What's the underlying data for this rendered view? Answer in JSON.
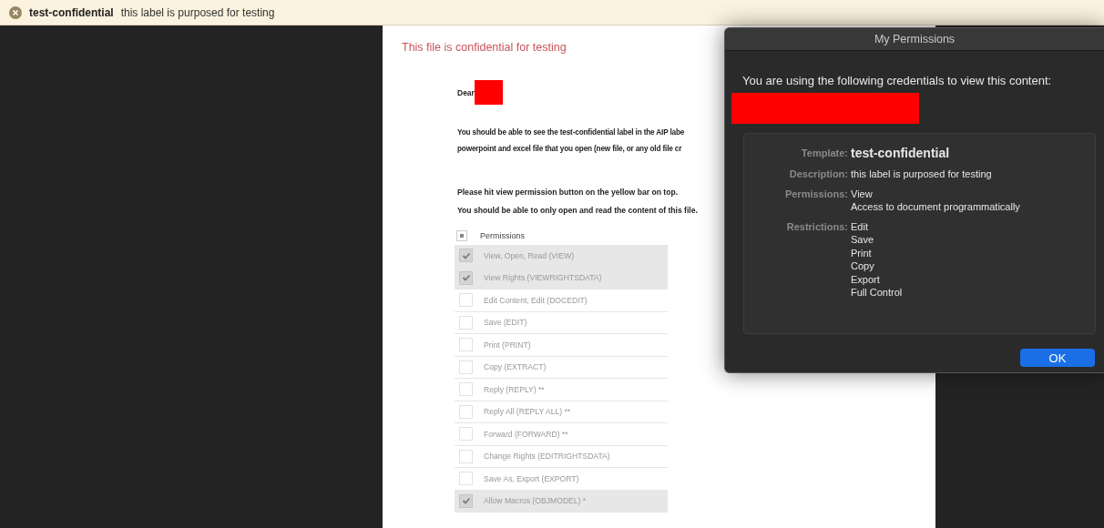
{
  "banner": {
    "label": "test-confidential",
    "description": "this label is purposed for testing"
  },
  "document": {
    "heading": "This file is confidential for testing",
    "greeting": "Dear",
    "paragraph_lines": [
      "You should be able to see the test-confidential label in the AIP labe",
      "powerpoint and excel file that you open (new file, or any old file cr"
    ],
    "instructions": [
      "Please hit view permission button on the yellow bar on top.",
      "You should be able to only open and read the content of this file."
    ],
    "permissions_table": {
      "header": "Permissions",
      "header_indeterminate": true,
      "rows": [
        {
          "label": "View, Open, Read (VIEW)",
          "checked": true
        },
        {
          "label": "View Rights (VIEWRIGHTSDATA)",
          "checked": true
        },
        {
          "label": "Edit Content, Edit (DOCEDIT)",
          "checked": false
        },
        {
          "label": "Save (EDIT)",
          "checked": false
        },
        {
          "label": "Print (PRINT)",
          "checked": false
        },
        {
          "label": "Copy (EXTRACT)",
          "checked": false
        },
        {
          "label": "Reply (REPLY) **",
          "checked": false
        },
        {
          "label": "Reply All (REPLY ALL) **",
          "checked": false
        },
        {
          "label": "Forward (FORWARD) **",
          "checked": false
        },
        {
          "label": "Change Rights (EDITRIGHTSDATA)",
          "checked": false
        },
        {
          "label": "Save As, Export (EXPORT)",
          "checked": false
        },
        {
          "label": "Allow Macros (OBJMODEL) *",
          "checked": true
        }
      ]
    }
  },
  "dialog": {
    "title": "My Permissions",
    "intro": "You are using the following credentials to view this content:",
    "details": [
      {
        "kind": "emphasis",
        "label": "Template:",
        "values": [
          "test-confidential"
        ]
      },
      {
        "kind": "list",
        "label": "Description:",
        "values": [
          "this label is purposed for testing"
        ]
      },
      {
        "kind": "list",
        "label": "Permissions:",
        "values": [
          "View",
          "Access to document programmatically"
        ]
      },
      {
        "kind": "list",
        "label": "Restrictions:",
        "values": [
          "Edit",
          "Save",
          "Print",
          "Copy",
          "Export",
          "Full Control"
        ]
      }
    ],
    "button": "OK"
  }
}
